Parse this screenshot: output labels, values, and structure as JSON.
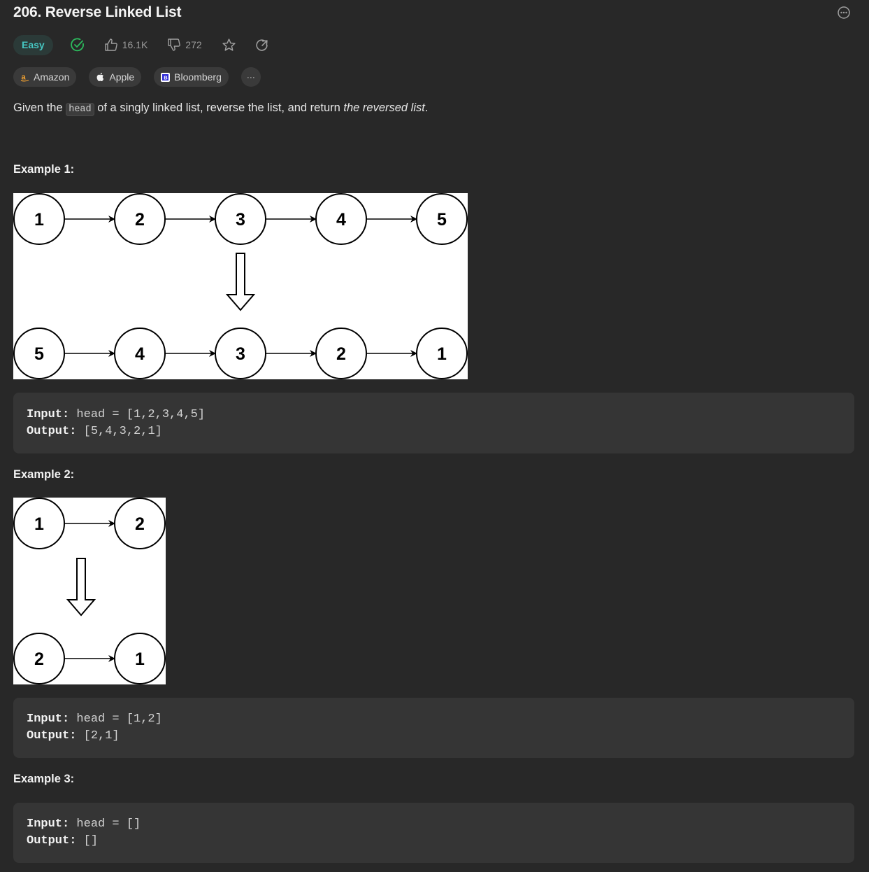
{
  "problem": {
    "title": "206. Reverse Linked List",
    "difficulty": "Easy",
    "likes": "16.1K",
    "dislikes": "272"
  },
  "companies": [
    {
      "name": "Amazon"
    },
    {
      "name": "Apple"
    },
    {
      "name": "Bloomberg"
    }
  ],
  "more_companies_label": "···",
  "description": {
    "prefix": "Given the ",
    "code": "head",
    "middle": " of a singly linked list, reverse the list, and return ",
    "emphasis": "the reversed list",
    "suffix": "."
  },
  "examples": [
    {
      "title": "Example 1:",
      "input_label": "Input:",
      "input_value": " head = [1,2,3,4,5]",
      "output_label": "Output:",
      "output_value": " [5,4,3,2,1]",
      "top_nodes": [
        "1",
        "2",
        "3",
        "4",
        "5"
      ],
      "bottom_nodes": [
        "5",
        "4",
        "3",
        "2",
        "1"
      ]
    },
    {
      "title": "Example 2:",
      "input_label": "Input:",
      "input_value": " head = [1,2]",
      "output_label": "Output:",
      "output_value": " [2,1]",
      "top_nodes": [
        "1",
        "2"
      ],
      "bottom_nodes": [
        "2",
        "1"
      ]
    },
    {
      "title": "Example 3:",
      "input_label": "Input:",
      "input_value": " head = []",
      "output_label": "Output:",
      "output_value": " []"
    }
  ],
  "colors": {
    "background": "#282828",
    "easy": "#46c6c2",
    "solved": "#2cbb5d"
  }
}
